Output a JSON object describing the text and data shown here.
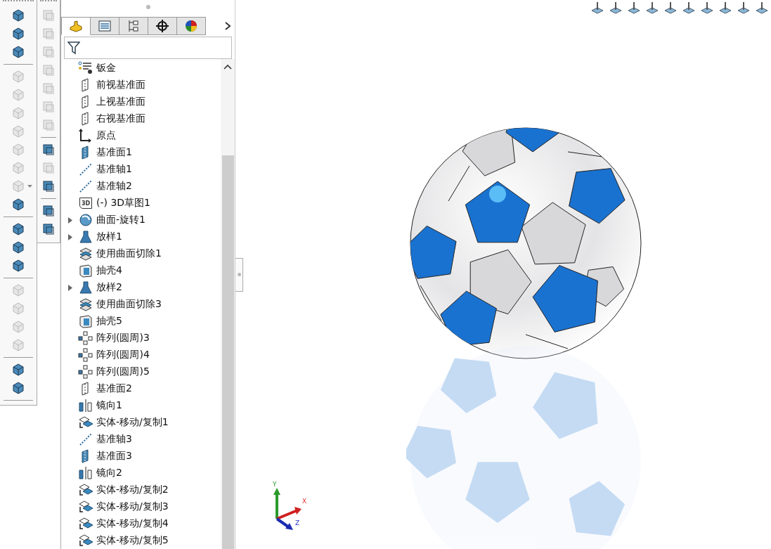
{
  "command_toolbar": {
    "items": [
      {
        "kind": "tool",
        "disabled": false
      },
      {
        "kind": "tool",
        "disabled": false
      },
      {
        "kind": "tool",
        "disabled": false
      },
      {
        "kind": "separator"
      },
      {
        "kind": "tool",
        "disabled": true
      },
      {
        "kind": "tool",
        "disabled": true
      },
      {
        "kind": "tool",
        "disabled": true
      },
      {
        "kind": "tool",
        "disabled": true
      },
      {
        "kind": "tool",
        "disabled": true
      },
      {
        "kind": "tool",
        "disabled": true
      },
      {
        "kind": "dropdown",
        "disabled": true
      },
      {
        "kind": "tool",
        "disabled": false
      },
      {
        "kind": "separator"
      },
      {
        "kind": "tool",
        "disabled": false
      },
      {
        "kind": "tool",
        "disabled": false
      },
      {
        "kind": "tool",
        "disabled": false
      },
      {
        "kind": "separator"
      },
      {
        "kind": "tool",
        "disabled": true
      },
      {
        "kind": "tool",
        "disabled": true
      },
      {
        "kind": "tool",
        "disabled": true
      },
      {
        "kind": "tool",
        "disabled": true
      },
      {
        "kind": "separator"
      },
      {
        "kind": "tool",
        "disabled": false
      },
      {
        "kind": "tool",
        "disabled": false
      },
      {
        "kind": "separator"
      }
    ]
  },
  "secondary_toolbar": {
    "items": [
      {
        "kind": "tool",
        "disabled": true
      },
      {
        "kind": "tool",
        "disabled": true
      },
      {
        "kind": "tool",
        "disabled": true
      },
      {
        "kind": "tool",
        "disabled": true
      },
      {
        "kind": "tool",
        "disabled": true
      },
      {
        "kind": "tool",
        "disabled": true
      },
      {
        "kind": "tool",
        "disabled": true
      },
      {
        "kind": "separator"
      },
      {
        "kind": "tool",
        "disabled": false
      },
      {
        "kind": "tool",
        "disabled": true
      },
      {
        "kind": "tool",
        "disabled": false
      },
      {
        "kind": "separator"
      },
      {
        "kind": "tool",
        "disabled": false
      },
      {
        "kind": "tool",
        "disabled": false
      }
    ]
  },
  "panel_tabs": [
    {
      "kind": "feature-manager",
      "selected": true
    },
    {
      "kind": "property-manager",
      "selected": false
    },
    {
      "kind": "configuration-manager",
      "selected": false
    },
    {
      "kind": "dimxpert",
      "selected": false
    },
    {
      "kind": "display-manager",
      "selected": false
    }
  ],
  "feature_tree": {
    "items": [
      {
        "label": "钣金",
        "kind": "sheetmetal",
        "expandable": false
      },
      {
        "label": "前视基准面",
        "kind": "plane",
        "expandable": false
      },
      {
        "label": "上视基准面",
        "kind": "plane",
        "expandable": false
      },
      {
        "label": "右视基准面",
        "kind": "plane",
        "expandable": false
      },
      {
        "label": "原点",
        "kind": "origin",
        "expandable": false
      },
      {
        "label": "基准面1",
        "kind": "plane-solid",
        "expandable": false
      },
      {
        "label": "基准轴1",
        "kind": "axis",
        "expandable": false
      },
      {
        "label": "基准轴2",
        "kind": "axis",
        "expandable": false
      },
      {
        "label": "(-) 3D草图1",
        "kind": "sketch3d",
        "icon_text": "3D",
        "expandable": false
      },
      {
        "label": "曲面-旋转1",
        "kind": "revolve",
        "expandable": true
      },
      {
        "label": "放样1",
        "kind": "loft",
        "expandable": true
      },
      {
        "label": "使用曲面切除1",
        "kind": "cut",
        "expandable": false
      },
      {
        "label": "抽壳4",
        "kind": "shell",
        "expandable": false
      },
      {
        "label": "放样2",
        "kind": "loft",
        "expandable": true
      },
      {
        "label": "使用曲面切除3",
        "kind": "cut",
        "expandable": false
      },
      {
        "label": "抽壳5",
        "kind": "shell",
        "expandable": false
      },
      {
        "label": "阵列(圆周)3",
        "kind": "pattern",
        "expandable": false
      },
      {
        "label": "阵列(圆周)4",
        "kind": "pattern",
        "expandable": false
      },
      {
        "label": "阵列(圆周)5",
        "kind": "pattern",
        "expandable": false
      },
      {
        "label": "基准面2",
        "kind": "plane",
        "expandable": false
      },
      {
        "label": "镜向1",
        "kind": "mirror",
        "expandable": false
      },
      {
        "label": "实体-移动/复制1",
        "kind": "move",
        "expandable": false
      },
      {
        "label": "基准轴3",
        "kind": "axis",
        "expandable": false
      },
      {
        "label": "基准面3",
        "kind": "plane-solid",
        "expandable": false
      },
      {
        "label": "镜向2",
        "kind": "mirror",
        "expandable": false
      },
      {
        "label": "实体-移动/复制2",
        "kind": "move",
        "expandable": false
      },
      {
        "label": "实体-移动/复制3",
        "kind": "move",
        "expandable": false
      },
      {
        "label": "实体-移动/复制4",
        "kind": "move",
        "expandable": false
      },
      {
        "label": "实体-移动/复制5",
        "kind": "move",
        "expandable": false
      }
    ]
  },
  "triad": {
    "x": "X",
    "y": "Y",
    "z": "Z"
  }
}
